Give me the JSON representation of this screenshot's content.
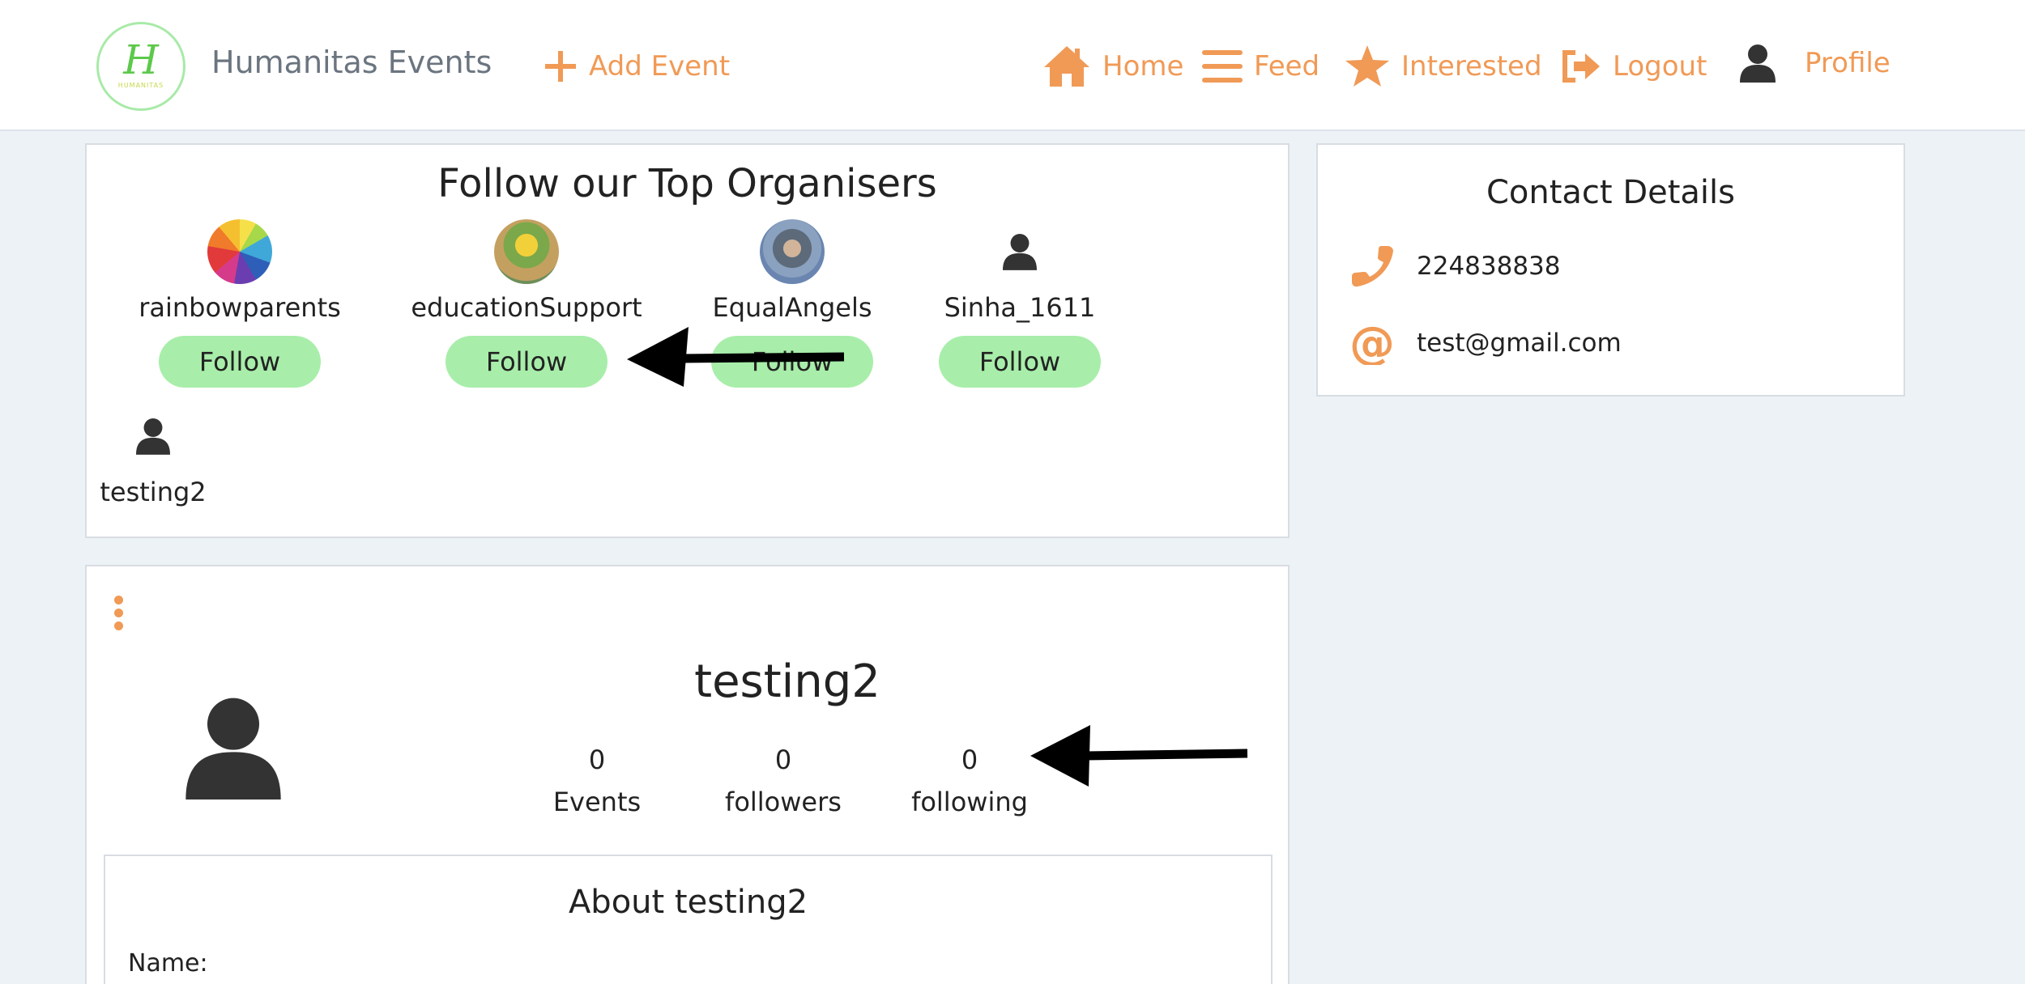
{
  "navbar": {
    "brand": "Humanitas Events",
    "logo_letter": "H",
    "logo_caption": "HUMANITAS",
    "add_event": "Add Event",
    "home": "Home",
    "feed": "Feed",
    "interested": "Interested",
    "logout": "Logout",
    "profile": "Profile"
  },
  "organisers": {
    "title": "Follow our Top Organisers",
    "follow_label": "Follow",
    "items": [
      {
        "name": "rainbowparents",
        "avatar": "rainbow-photo"
      },
      {
        "name": "educationSupport",
        "avatar": "group-photo"
      },
      {
        "name": "EqualAngels",
        "avatar": "person-photo"
      },
      {
        "name": "Sinha_1611",
        "avatar": "user-icon"
      },
      {
        "name": "testing2",
        "avatar": "user-icon"
      }
    ]
  },
  "contact": {
    "title": "Contact Details",
    "phone": "224838838",
    "email": "test@gmail.com"
  },
  "profile": {
    "username": "testing2",
    "stats": {
      "events_count": "0",
      "events_label": "Events",
      "followers_count": "0",
      "followers_label": "followers",
      "following_count": "0",
      "following_label": "following"
    },
    "about_title": "About testing2",
    "name_label": "Name:"
  },
  "colors": {
    "accent": "#f09a56",
    "follow_button": "#a8eeaa",
    "background": "#edf2f7"
  }
}
